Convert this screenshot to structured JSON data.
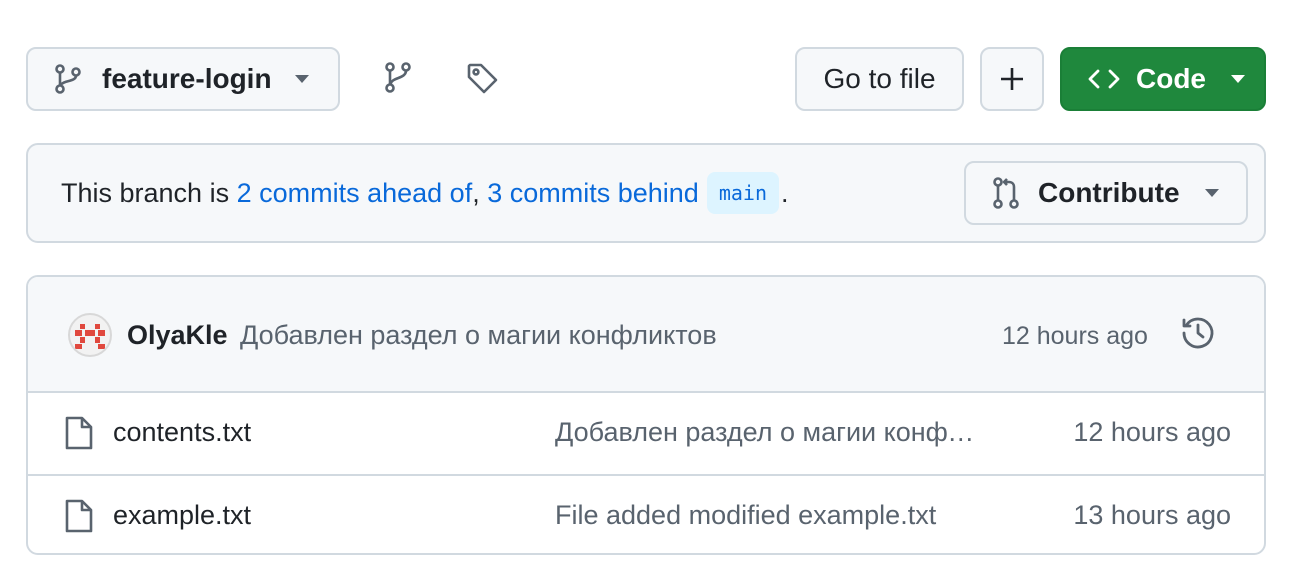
{
  "toolbar": {
    "branch_name": "feature-login",
    "go_to_file_label": "Go to file",
    "add_file_label": "+",
    "code_label": "Code",
    "code_button_color": "#1f883d"
  },
  "compare": {
    "prefix": "This branch is ",
    "ahead_link": "2 commits ahead of",
    "separator": ", ",
    "behind_link": "3 commits behind",
    "base_branch": "main",
    "suffix": ".",
    "contribute_label": "Contribute"
  },
  "latest_commit": {
    "author": "OlyaKle",
    "message": "Добавлен раздел о магии конфликтов",
    "time": "12 hours ago"
  },
  "files": [
    {
      "name": "contents.txt",
      "message": "Добавлен раздел о магии конфликтов",
      "time": "12 hours ago",
      "icon": "file-icon"
    },
    {
      "name": "example.txt",
      "message": "File added modified example.txt",
      "time": "13 hours ago",
      "icon": "file-icon"
    }
  ],
  "colors": {
    "link": "#0969da",
    "muted": "#59636e",
    "border": "#d1d9e0"
  }
}
